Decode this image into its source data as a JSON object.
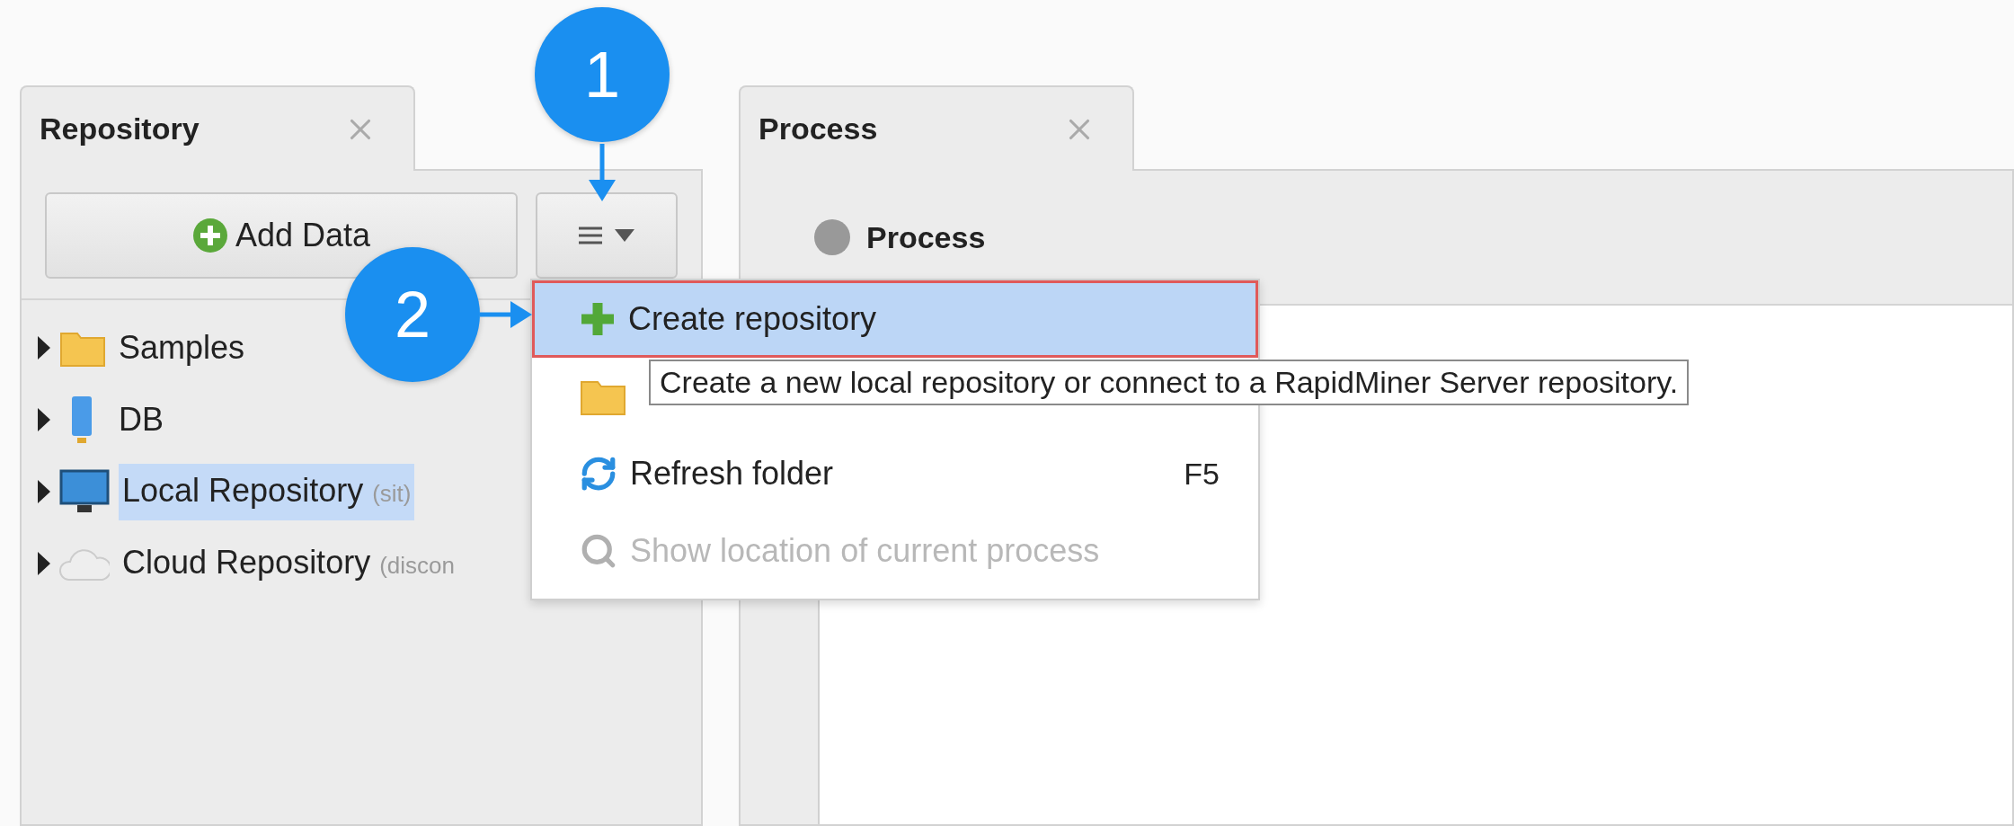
{
  "repository_panel": {
    "tab": {
      "title": "Repository",
      "selected": true
    },
    "add_button": {
      "label": "Add Data"
    },
    "tree": [
      {
        "kind": "folder",
        "label": "Samples",
        "selected": false
      },
      {
        "kind": "database",
        "label": "DB",
        "selected": false
      },
      {
        "kind": "computer",
        "label": "Local Repository",
        "note": "(sit)",
        "selected": true
      },
      {
        "kind": "cloud",
        "label": "Cloud Repository",
        "note": "(discon",
        "selected": false
      }
    ]
  },
  "process_panel": {
    "tab": {
      "title": "Process",
      "selected": true
    },
    "breadcrumb": "Process"
  },
  "menu": {
    "items": [
      {
        "kind": "add",
        "label": "Create repository",
        "highlighted": true,
        "disabled": false
      },
      {
        "kind": "folder",
        "highlighted": false
      },
      {
        "kind": "refresh",
        "label": "Refresh folder",
        "shortcut": "F5",
        "highlighted": false,
        "disabled": false
      },
      {
        "kind": "locate",
        "label": "Show location of current process",
        "highlighted": false,
        "disabled": true
      }
    ]
  },
  "tooltip": "Create a new local repository or connect to a RapidMiner Server repository.",
  "callouts": [
    "1",
    "2"
  ]
}
